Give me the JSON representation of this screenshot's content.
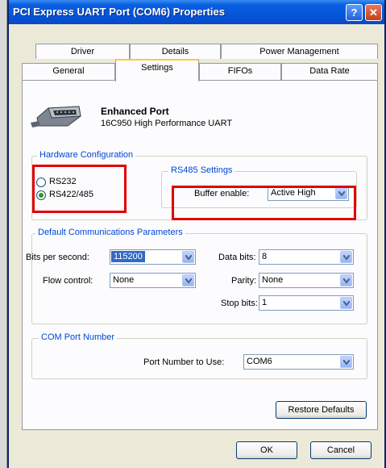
{
  "window": {
    "title": "PCI Express UART Port (COM6) Properties",
    "help_glyph": "?",
    "close_glyph": "✕"
  },
  "tabs": {
    "row1": [
      {
        "label": "Driver"
      },
      {
        "label": "Details"
      },
      {
        "label": "Power Management"
      }
    ],
    "row2": [
      {
        "label": "General"
      },
      {
        "label": "Settings"
      },
      {
        "label": "FIFOs"
      },
      {
        "label": "Data Rate"
      }
    ],
    "active": "Settings"
  },
  "port": {
    "name": "Enhanced Port",
    "description": "16C950 High Performance UART",
    "icon": "serial-port-icon"
  },
  "hardware": {
    "legend": "Hardware Configuration",
    "options": [
      {
        "label": "RS232",
        "selected": false
      },
      {
        "label": "RS422/485",
        "selected": true
      }
    ]
  },
  "rs485": {
    "legend": "RS485 Settings",
    "buffer_label": "Buffer enable:",
    "buffer_value": "Active High"
  },
  "comm": {
    "legend": "Default Communications Parameters",
    "bits_label": "Bits per second:",
    "bits_value": "115200",
    "flow_label": "Flow control:",
    "flow_value": "None",
    "data_label": "Data bits:",
    "data_value": "8",
    "parity_label": "Parity:",
    "parity_value": "None",
    "stop_label": "Stop bits:",
    "stop_value": "1"
  },
  "com_port": {
    "legend": "COM Port Number",
    "label": "Port Number to Use:",
    "value": "COM6"
  },
  "buttons": {
    "restore": "Restore Defaults",
    "ok": "OK",
    "cancel": "Cancel"
  },
  "colors": {
    "title_bar": "#0553d6",
    "legend_text": "#0046d5",
    "highlight_box": "#e00000",
    "selection": "#316ac5"
  }
}
